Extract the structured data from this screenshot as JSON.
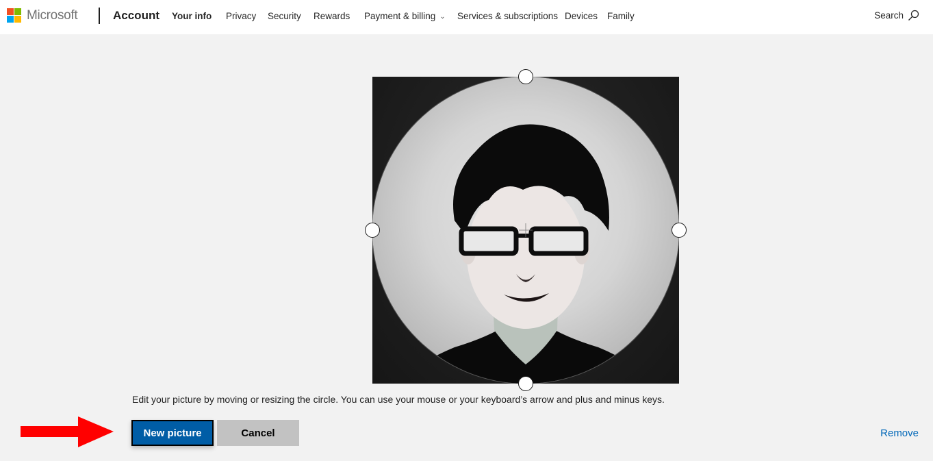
{
  "header": {
    "brand": "Microsoft",
    "brand_colors": [
      "#f25022",
      "#7fba00",
      "#00a4ef",
      "#ffb900"
    ],
    "section_title": "Account",
    "nav": [
      {
        "label": "Your info",
        "active": true
      },
      {
        "label": "Privacy"
      },
      {
        "label": "Security"
      },
      {
        "label": "Rewards"
      },
      {
        "label": "Payment & billing",
        "has_dropdown": true
      },
      {
        "label": "Services & subscriptions"
      },
      {
        "label": "Devices"
      },
      {
        "label": "Family"
      }
    ],
    "search_label": "Search",
    "search_icon": "search-icon",
    "dropdown_icon": "chevron-down-icon"
  },
  "editor": {
    "image_alt": "Profile photo of a young man with dark hair and black glasses",
    "handles": [
      "top",
      "left",
      "right",
      "bottom"
    ],
    "instructions": "Edit your picture by moving or resizing the circle. You can use your mouse or your keyboard’s arrow and plus and minus keys."
  },
  "actions": {
    "new_picture_label": "New picture",
    "cancel_label": "Cancel",
    "remove_label": "Remove"
  },
  "annotation": {
    "arrow_color": "#ff0000",
    "arrow_target": "New picture"
  },
  "colors": {
    "primary_button": "#005da6",
    "secondary_button": "#c2c2c2",
    "link": "#0067b8",
    "background": "#f2f2f2"
  }
}
